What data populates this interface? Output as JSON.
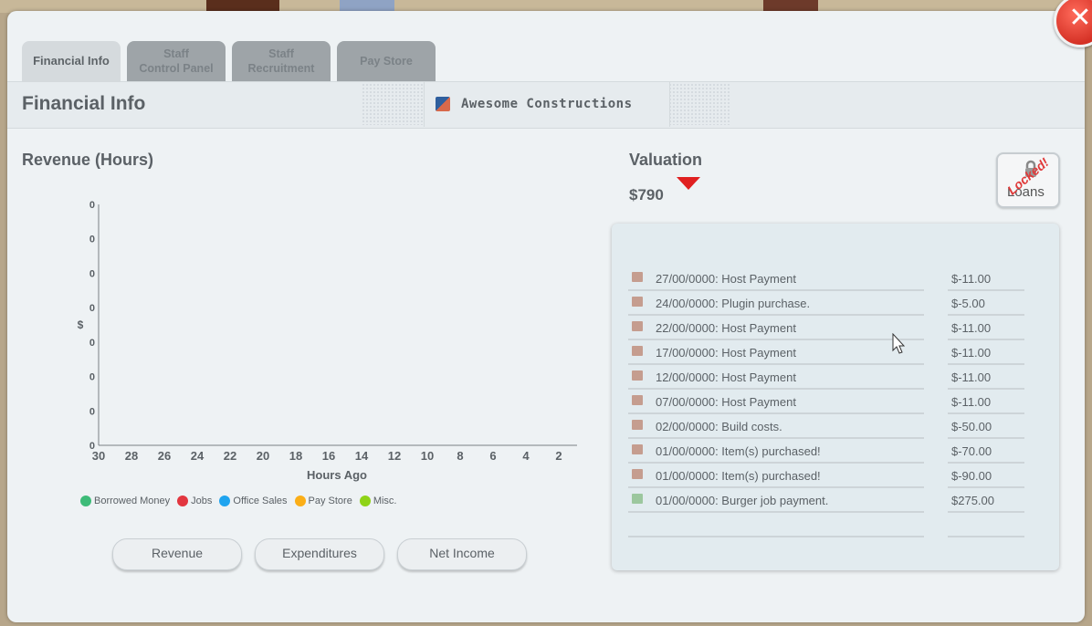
{
  "tabs": [
    {
      "label": "Financial Info",
      "active": true
    },
    {
      "label": "Staff\nControl Panel",
      "active": false
    },
    {
      "label": "Staff\nRecruitment",
      "active": false
    },
    {
      "label": "Pay Store",
      "active": false
    }
  ],
  "header": {
    "title": "Financial Info",
    "company": "Awesome Constructions"
  },
  "revenue": {
    "title": "Revenue (Hours)",
    "buttons": {
      "revenue": "Revenue",
      "expenditures": "Expenditures",
      "net_income": "Net Income"
    }
  },
  "chart_data": {
    "type": "line",
    "title": "Revenue (Hours)",
    "xlabel": "Hours Ago",
    "ylabel": "$",
    "x_ticks": [
      "30",
      "28",
      "26",
      "24",
      "22",
      "20",
      "18",
      "16",
      "14",
      "12",
      "10",
      "8",
      "6",
      "4",
      "2"
    ],
    "y_ticks": [
      "0",
      "0",
      "0",
      "0",
      "0",
      "0",
      "0",
      "0"
    ],
    "series": [
      {
        "name": "Borrowed Money",
        "color": "#3dbb78",
        "values": []
      },
      {
        "name": "Jobs",
        "color": "#e2363f",
        "values": []
      },
      {
        "name": "Office Sales",
        "color": "#1fa4ef",
        "values": []
      },
      {
        "name": "Pay Store",
        "color": "#fbae17",
        "values": []
      },
      {
        "name": "Misc.",
        "color": "#8fd317",
        "values": []
      }
    ],
    "legend_placement": "bottom",
    "grid": false
  },
  "valuation": {
    "title": "Valuation",
    "value": "$790",
    "trend": "down"
  },
  "loans": {
    "label": "Loans",
    "stamp": "Locked!"
  },
  "transactions": {
    "rows": [
      {
        "desc": "27/00/0000: Host Payment",
        "amount": "$-11.00",
        "type": "neg"
      },
      {
        "desc": "24/00/0000: Plugin purchase.",
        "amount": "$-5.00",
        "type": "neg"
      },
      {
        "desc": "22/00/0000: Host Payment",
        "amount": "$-11.00",
        "type": "neg"
      },
      {
        "desc": "17/00/0000: Host Payment",
        "amount": "$-11.00",
        "type": "neg"
      },
      {
        "desc": "12/00/0000: Host Payment",
        "amount": "$-11.00",
        "type": "neg"
      },
      {
        "desc": "07/00/0000: Host Payment",
        "amount": "$-11.00",
        "type": "neg"
      },
      {
        "desc": "02/00/0000: Build costs.",
        "amount": "$-50.00",
        "type": "neg"
      },
      {
        "desc": "01/00/0000: Item(s) purchased!",
        "amount": "$-70.00",
        "type": "neg"
      },
      {
        "desc": "01/00/0000: Item(s) purchased!",
        "amount": "$-90.00",
        "type": "neg"
      },
      {
        "desc": "01/00/0000: Burger job payment.",
        "amount": "$275.00",
        "type": "pos"
      }
    ]
  }
}
